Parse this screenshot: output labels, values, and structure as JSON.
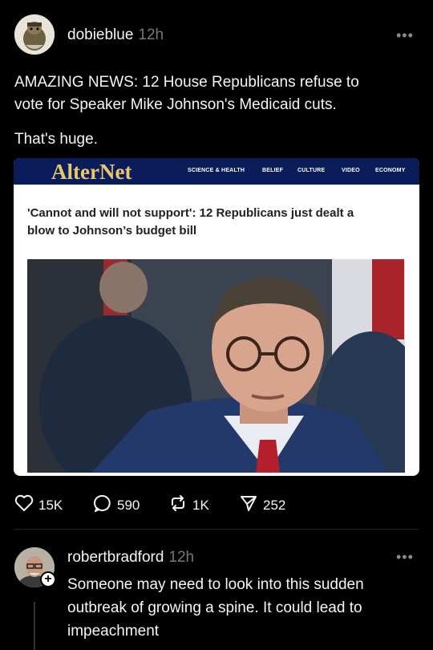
{
  "post": {
    "username": "dobieblue",
    "time": "12h",
    "more": "•••",
    "text_line1": "AMAZING NEWS: 12 House Republicans refuse to",
    "text_line2": "vote for Speaker Mike Johnson's Medicaid cuts.",
    "text_line3": "That's huge."
  },
  "card": {
    "logo": "AlterNet",
    "nav": [
      "SCIENCE & HEALTH",
      "BELIEF",
      "CULTURE",
      "VIDEO",
      "ECONOMY"
    ],
    "headline_line1": "'Cannot and will not support': 12 Republicans just dealt a",
    "headline_line2": "blow to Johnson’s budget bill"
  },
  "actions": {
    "likes": "15K",
    "comments": "590",
    "reposts": "1K",
    "shares": "252"
  },
  "reply": {
    "username": "robertbradford",
    "time": "12h",
    "more": "•••",
    "text_line1": "Someone may need to look into this sudden",
    "text_line2": "outbreak of growing a spine.  It could lead to",
    "text_line3": "impeachment"
  },
  "colors": {
    "background": "#000000",
    "alternet_nav": "#0b1c5a",
    "alternet_logo": "#e8c76a"
  }
}
